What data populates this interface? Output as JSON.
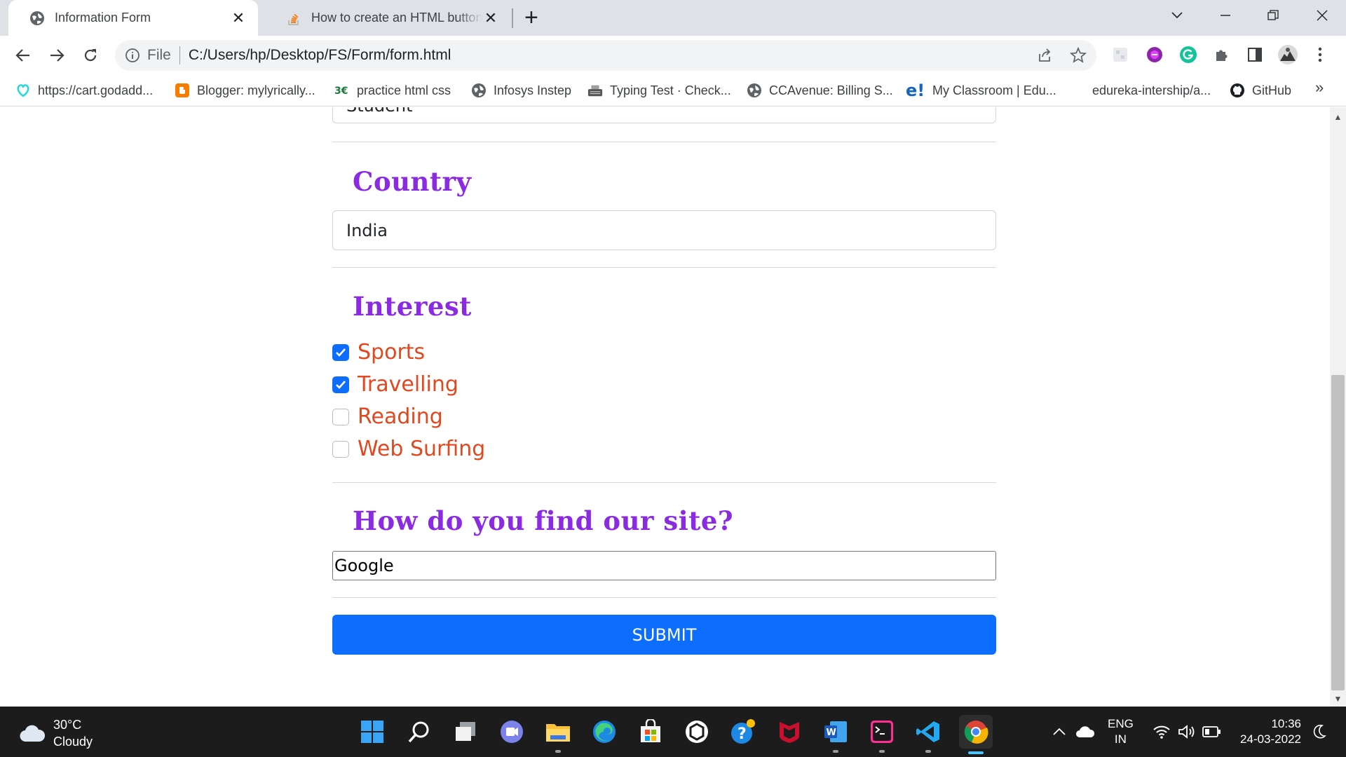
{
  "tabs": [
    {
      "title": "Information Form",
      "active": true
    },
    {
      "title": "How to create an HTML button that acts like a link",
      "active": false
    }
  ],
  "toolbar": {
    "scheme_label": "File",
    "url": "C:/Users/hp/Desktop/FS/Form/form.html"
  },
  "bookmarks": [
    {
      "label": "https://cart.godadd...",
      "icon": "godaddy-icon"
    },
    {
      "label": "Blogger: mylyrically...",
      "icon": "blogger-icon"
    },
    {
      "label": "practice html css",
      "icon": "html-icon"
    },
    {
      "label": "Infosys Instep",
      "icon": "globe-icon"
    },
    {
      "label": "Typing Test · Check...",
      "icon": "typewriter-icon"
    },
    {
      "label": "CCAvenue: Billing S...",
      "icon": "globe-icon"
    },
    {
      "label": "My Classroom | Edu...",
      "icon": "edureka-icon"
    },
    {
      "label": "edureka-intership/a...",
      "icon": "folder-icon"
    },
    {
      "label": "GitHub",
      "icon": "github-icon"
    }
  ],
  "bookmarks_more": "»",
  "form": {
    "top_input_value": "Student",
    "country_heading": "Country",
    "country_value": "India",
    "interest_heading": "Interest",
    "interests": [
      {
        "label": "Sports",
        "checked": true
      },
      {
        "label": "Travelling",
        "checked": true
      },
      {
        "label": "Reading",
        "checked": false
      },
      {
        "label": "Web Surfing",
        "checked": false
      }
    ],
    "find_heading": "How do you find our site?",
    "find_value": "Google",
    "submit_label": "SUBMIT"
  },
  "taskbar": {
    "temperature": "30°C",
    "condition": "Cloudy",
    "lang_line1": "ENG",
    "lang_line2": "IN",
    "time": "10:36",
    "date": "24-03-2022"
  },
  "colors": {
    "heading": "#8a2be2",
    "interest_label": "#e0481f",
    "primary": "#0d6efd"
  }
}
